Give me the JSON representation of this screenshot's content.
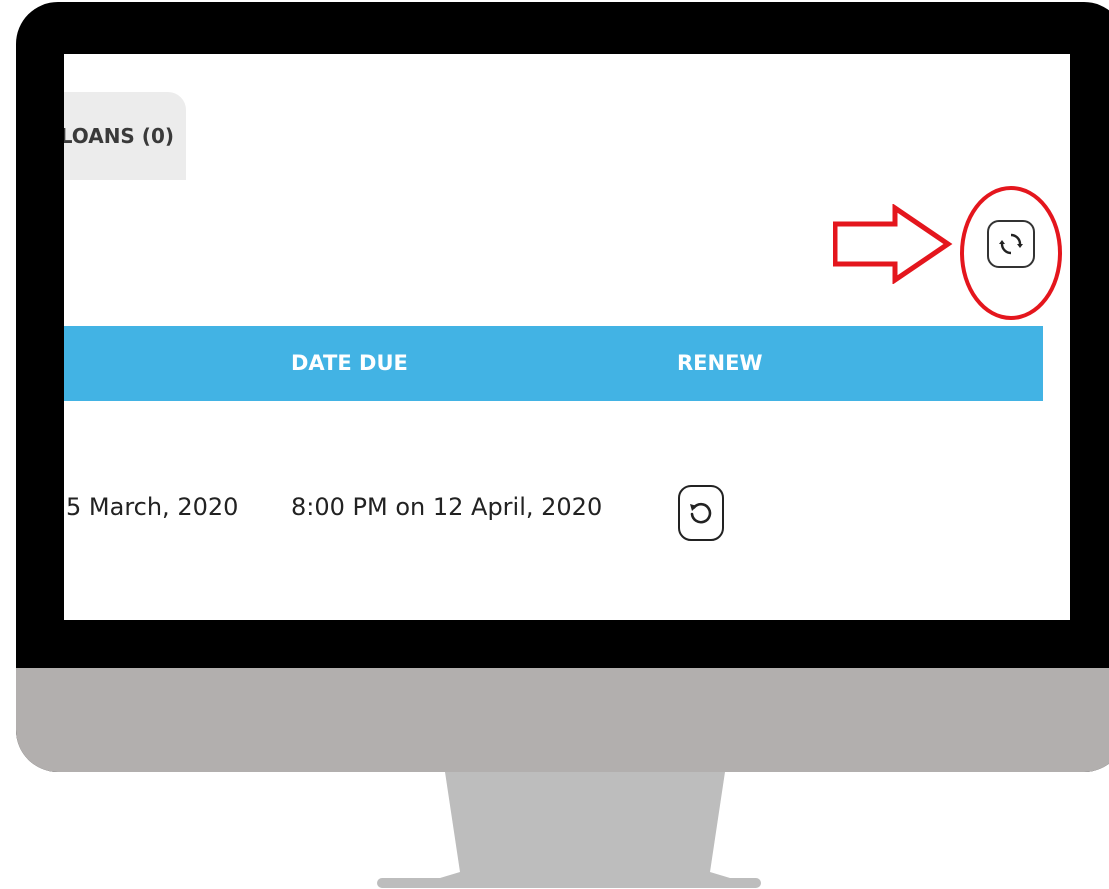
{
  "tabs": {
    "loans_label": "LOANS (0)"
  },
  "toolbar": {
    "refresh_icon": "refresh-cycle-icon"
  },
  "annotation": {
    "arrow_color": "#e4161d",
    "circle_color": "#e4161d"
  },
  "table": {
    "header_color": "#42b3e4",
    "columns": [
      "DATE DUE",
      "RENEW"
    ],
    "rows": [
      {
        "checked_out": "5 March, 2020",
        "date_due": "8:00 PM on 12 April, 2020",
        "renew_icon": "renew-rotate-icon"
      }
    ]
  }
}
